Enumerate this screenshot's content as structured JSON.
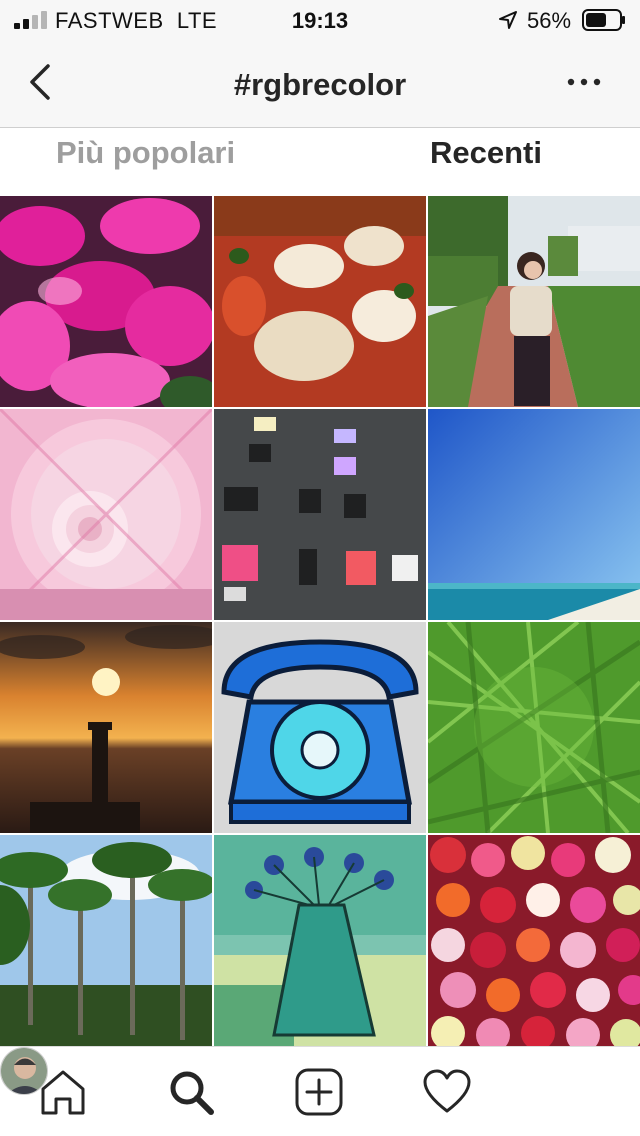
{
  "status_bar": {
    "carrier": "FASTWEB",
    "network": "LTE",
    "time": "19:13",
    "battery_percent": "56%",
    "icons": [
      "signal-bars-icon",
      "location-arrow-icon",
      "battery-icon"
    ]
  },
  "header": {
    "title": "#rgbrecolor",
    "icons": [
      "back-chevron-icon",
      "more-options-icon"
    ]
  },
  "tabs": [
    {
      "label": "Più popolari",
      "active": false
    },
    {
      "label": "Recenti",
      "active": true
    }
  ],
  "tab_bar": {
    "icons": [
      "home-icon",
      "search-icon",
      "add-post-icon",
      "heart-icon",
      "profile-avatar"
    ]
  },
  "colors": {
    "text": "#262626",
    "inactive_tab": "#9e9e9e",
    "bar_background": "#f7f7f7"
  }
}
